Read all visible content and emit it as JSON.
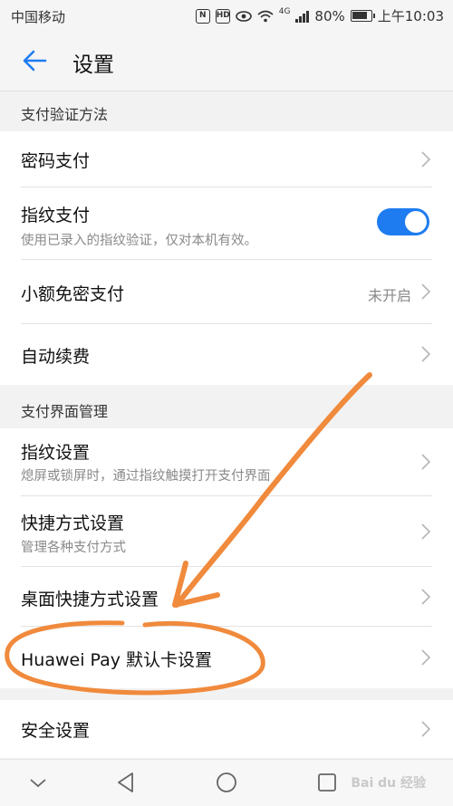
{
  "status_bar": {
    "carrier": "中国移动",
    "battery": "80%",
    "time": "上午10:03",
    "network": "4G",
    "hd": "HD"
  },
  "header": {
    "title": "设置",
    "back_icon": "arrow-left-icon"
  },
  "sections": [
    {
      "label": "支付验证方法"
    },
    {
      "label": "支付界面管理"
    }
  ],
  "items": [
    {
      "label": "密码支付"
    },
    {
      "label": "指纹支付",
      "sub": "使用已录入的指纹验证，仅对本机有效。",
      "toggle": true
    },
    {
      "label": "小额免密支付",
      "status": "未开启"
    },
    {
      "label": "自动续费"
    },
    {
      "label": "指纹设置",
      "sub": "熄屏或锁屏时，通过指纹触摸打开支付界面"
    },
    {
      "label": "快捷方式设置",
      "sub": "管理各种支付方式"
    },
    {
      "label": "桌面快捷方式设置"
    },
    {
      "label": "Huawei Pay 默认卡设置"
    },
    {
      "label": "安全设置"
    }
  ],
  "watermark": "Bai du 经验",
  "colors": {
    "accent": "#1e7cf0",
    "annotation": "#f08a3c"
  }
}
